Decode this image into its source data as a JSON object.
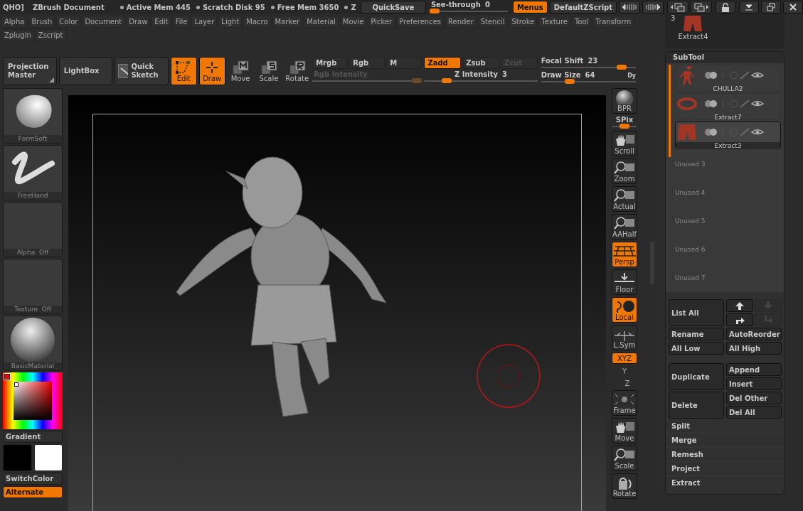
{
  "title_bar": {
    "prefix": "QHO]",
    "document": "ZBrush Document",
    "stats": [
      "Active Mem 445",
      "Scratch Disk 95",
      "Free Mem 3650",
      "Z"
    ],
    "quicksave": "QuickSave",
    "see_through": {
      "label": "See-through",
      "value": "0",
      "level": 0.05
    },
    "menus": {
      "label": "Menus",
      "on": true
    },
    "script": "DefaultZScript"
  },
  "menu_rows": [
    [
      "Alpha",
      "Brush",
      "Color",
      "Document",
      "Draw",
      "Edit",
      "File",
      "Layer",
      "Light",
      "Macro",
      "Marker",
      "Material",
      "Movie",
      "Picker",
      "Preferences",
      "Render",
      "Stencil",
      "Stroke",
      "Texture",
      "Tool",
      "Transform"
    ],
    [
      "Zplugin",
      "Zscript"
    ]
  ],
  "toolbar": {
    "projection_master": "Projection Master",
    "lightbox": "LightBox",
    "quick_sketch": "Quick Sketch",
    "modes": [
      {
        "kind": "edit",
        "label": "Edit",
        "on": true
      },
      {
        "kind": "draw",
        "label": "Draw",
        "on": true
      },
      {
        "kind": "move",
        "label": "Move",
        "on": false
      },
      {
        "kind": "scale",
        "label": "Scale",
        "on": false
      },
      {
        "kind": "rotate",
        "label": "Rotate",
        "on": false
      }
    ],
    "color_modes": [
      {
        "label": "Mrgb",
        "selected": false
      },
      {
        "label": "Rgb",
        "selected": false
      },
      {
        "label": "M",
        "selected": false
      }
    ],
    "rgb_intensity": {
      "label": "Rgb Intensity",
      "disabled": true,
      "level": 0.95
    },
    "z_modes": [
      {
        "label": "Zadd",
        "selected": true,
        "disabled": false
      },
      {
        "label": "Zsub",
        "selected": false,
        "disabled": false
      },
      {
        "label": "Zcut",
        "selected": false,
        "disabled": true
      }
    ],
    "z_intensity": {
      "label": "Z Intensity",
      "value": "3",
      "level": 0.2
    },
    "focal_shift": {
      "label": "Focal Shift",
      "value": "23",
      "level": 0.85
    },
    "draw_size": {
      "label": "Draw Size",
      "value": "64",
      "level": 0.3
    },
    "cut_label": "Dy"
  },
  "left_shelf": {
    "slots": [
      {
        "kind": "brush",
        "label": "FormSoft"
      },
      {
        "kind": "stroke",
        "label": "FreeHand"
      },
      {
        "kind": "empty",
        "label": "Alpha  Off"
      },
      {
        "kind": "empty",
        "label": "Texture  Off"
      },
      {
        "kind": "material",
        "label": "BasicMaterial"
      }
    ],
    "gradient": "Gradient",
    "switch_color": "SwitchColor",
    "alternate": {
      "label": "Alternate",
      "on": true
    }
  },
  "right_shelf": [
    {
      "kind": "bpr",
      "label": "BPR",
      "on": false
    },
    {
      "kind": "spix",
      "label": "SPix",
      "level": 0.5
    },
    {
      "kind": "scroll",
      "label": "Scroll",
      "on": false
    },
    {
      "kind": "zoom",
      "label": "Zoom",
      "on": false
    },
    {
      "kind": "actual",
      "label": "Actual",
      "on": false
    },
    {
      "kind": "aahalf",
      "label": "AAHalf",
      "on": false
    },
    {
      "kind": "persp",
      "label": "Persp",
      "on": true
    },
    {
      "kind": "floor",
      "label": "Floor",
      "on": false
    },
    {
      "kind": "local",
      "label": "Local",
      "on": true
    },
    {
      "kind": "lsym",
      "label": "L.Sym",
      "on": false
    },
    {
      "kind": "xyz",
      "label": "XYZ",
      "on": true
    },
    {
      "kind": "y",
      "label": "Y",
      "on": false
    },
    {
      "kind": "z",
      "label": "Z",
      "on": false
    },
    {
      "kind": "frame",
      "label": "Frame",
      "on": false
    },
    {
      "kind": "move",
      "label": "Move",
      "on": false
    },
    {
      "kind": "scale",
      "label": "Scale",
      "on": false
    },
    {
      "kind": "rotate",
      "label": "Rotate",
      "on": false
    }
  ],
  "tool": {
    "count": "3",
    "name": "Extract4"
  },
  "subtool": {
    "title": "SubTool",
    "items": [
      {
        "kind": "figure",
        "name": "CHULLA2",
        "selected": false
      },
      {
        "kind": "ring",
        "name": "Extract7",
        "selected": false
      },
      {
        "kind": "pants",
        "name": "Extract3",
        "selected": true
      }
    ],
    "unused": [
      "Unused  3",
      "Unused  4",
      "Unused  5",
      "Unused  6",
      "Unused  7"
    ],
    "list_all": "List All",
    "arrows": [
      {
        "kind": "up",
        "disabled": false
      },
      {
        "kind": "down",
        "disabled": true
      },
      {
        "kind": "turn",
        "disabled": false
      },
      {
        "kind": "turn_down",
        "disabled": true
      }
    ],
    "rename": "Rename",
    "auto_reorder": "AutoReorder",
    "all_low": "All Low",
    "all_high": "All High",
    "duplicate": "Duplicate",
    "append": "Append",
    "insert": "Insert",
    "delete": "Delete",
    "del_other": "Del Other",
    "del_all": "Del All",
    "actions": [
      "Split",
      "Merge",
      "Remesh",
      "Project",
      "Extract"
    ]
  }
}
